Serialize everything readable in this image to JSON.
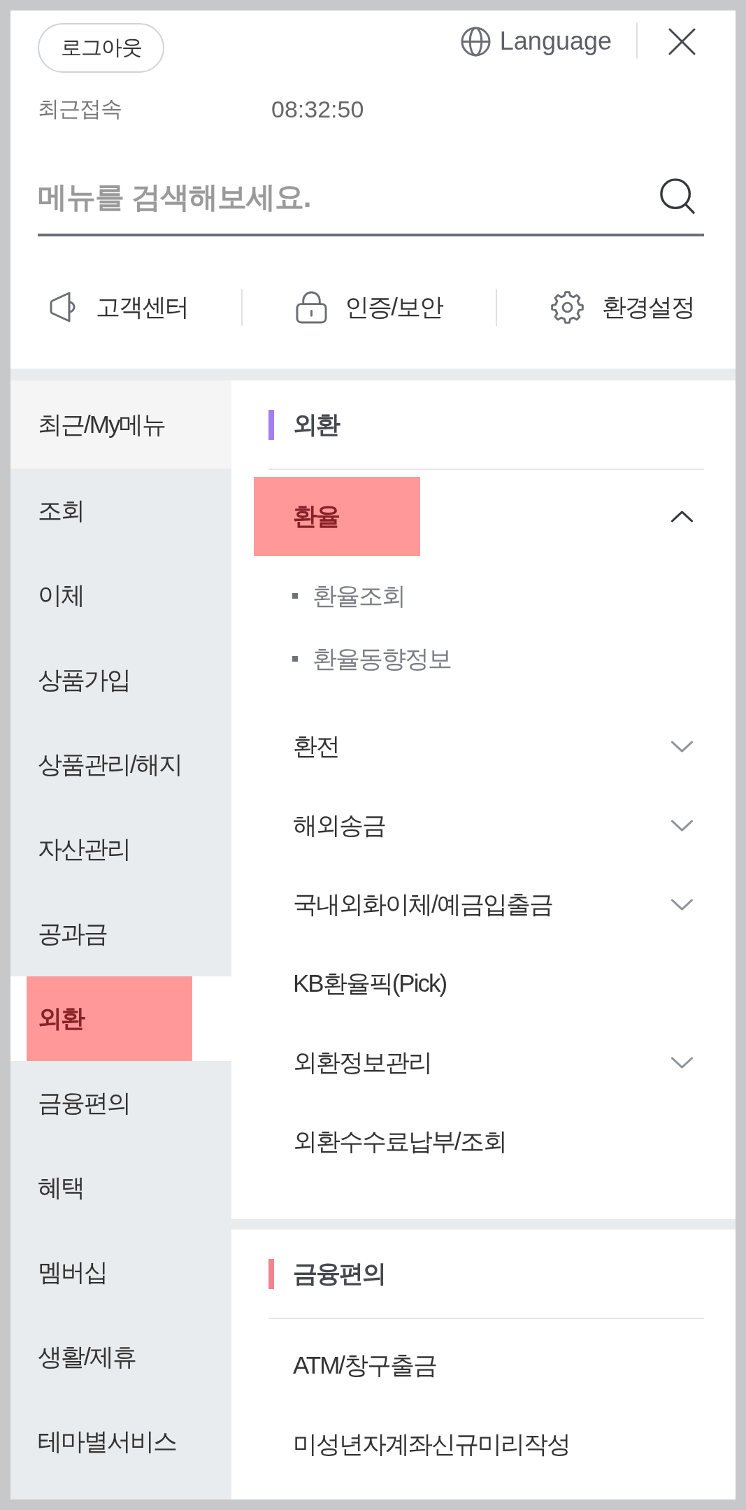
{
  "header": {
    "logout_button": "로그아웃",
    "language_button": "Language",
    "last_login_label": "최근접속",
    "last_login_time": "08:32:50"
  },
  "search": {
    "placeholder": "메뉴를 검색해보세요."
  },
  "shortcuts": [
    {
      "label": "고객센터"
    },
    {
      "label": "인증/보안"
    },
    {
      "label": "환경설정"
    }
  ],
  "categories": [
    {
      "label": "최근/My메뉴",
      "kind": "recent",
      "selected": false
    },
    {
      "label": "조회",
      "kind": "category",
      "selected": false
    },
    {
      "label": "이체",
      "kind": "category",
      "selected": false
    },
    {
      "label": "상품가입",
      "kind": "category",
      "selected": false
    },
    {
      "label": "상품관리/해지",
      "kind": "category",
      "selected": false
    },
    {
      "label": "자산관리",
      "kind": "category",
      "selected": false
    },
    {
      "label": "공과금",
      "kind": "category",
      "selected": false
    },
    {
      "label": "외환",
      "kind": "category",
      "selected": true
    },
    {
      "label": "금융편의",
      "kind": "category",
      "selected": false
    },
    {
      "label": "혜택",
      "kind": "category",
      "selected": false
    },
    {
      "label": "멤버십",
      "kind": "category",
      "selected": false
    },
    {
      "label": "생활/제휴",
      "kind": "category",
      "selected": false
    },
    {
      "label": "테마별서비스",
      "kind": "category",
      "selected": false
    }
  ],
  "sections": [
    {
      "title": "외환",
      "color": "#a27ff0",
      "items": [
        {
          "label": "환율",
          "kind": "group",
          "expanded": true,
          "selected": true,
          "children": [
            {
              "label": "환율조회"
            },
            {
              "label": "환율동향정보"
            }
          ]
        },
        {
          "label": "환전",
          "kind": "group",
          "expanded": false,
          "selected": false
        },
        {
          "label": "해외송금",
          "kind": "group",
          "expanded": false,
          "selected": false
        },
        {
          "label": "국내외화이체/예금입출금",
          "kind": "group",
          "expanded": false,
          "selected": false
        },
        {
          "label": "KB환율픽(Pick)",
          "kind": "link",
          "selected": false
        },
        {
          "label": "외환정보관리",
          "kind": "group",
          "expanded": false,
          "selected": false
        },
        {
          "label": "외환수수료납부/조회",
          "kind": "link",
          "selected": false
        }
      ]
    },
    {
      "title": "금융편의",
      "color": "#f2848f",
      "items": [
        {
          "label": "ATM/창구출금",
          "kind": "link",
          "selected": false
        },
        {
          "label": "미성년자계좌신규미리작성",
          "kind": "link",
          "selected": false
        }
      ]
    }
  ]
}
